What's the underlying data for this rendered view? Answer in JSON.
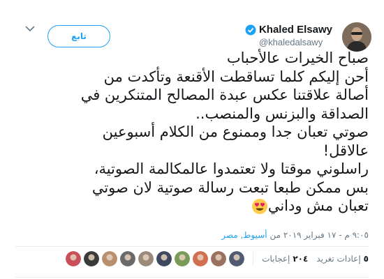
{
  "header": {
    "follow_label": "تابع",
    "display_name": "Khaled Elsawy",
    "handle": "@khaledalsawy"
  },
  "tweet": {
    "lines": [
      "صباح الخيرات عالأحباب",
      "أحن إليكم كلما تساقطت الأقنعة وتأكدت من",
      "أصالة علاقتنا عكس عبدة المصالح المتنكرين في",
      "الصداقة والبزنس والمنصب..",
      "صوتي تعبان جدا وممنوع من الكلام أسبوعين",
      "عالاقل!",
      "راسلوني موقتا ولا تعتمدوا عالمكالمة الصوتية،",
      "بس ممكن طبعا تبعت رسالة صوتية لان صوتي",
      "تعبان مش وداني"
    ],
    "emoji": "heart-eyes-emoji"
  },
  "meta": {
    "timestamp": "٩:٠٥ م - ١٧ فبراير ٢٠١٩ من",
    "location": "أسيوط, مصر"
  },
  "stats": {
    "retweets_count": "٥",
    "retweets_label": "إعادات تغريد",
    "likes_count": "٢٠٤",
    "likes_label": "إعجابات"
  },
  "likers": [
    {
      "name": "liker-1",
      "color": "#c94f5a"
    },
    {
      "name": "liker-2",
      "color": "#3a3a3a"
    },
    {
      "name": "liker-3",
      "color": "#b89070"
    },
    {
      "name": "liker-4",
      "color": "#6a6a6a"
    },
    {
      "name": "liker-5",
      "color": "#9a8a7a"
    },
    {
      "name": "liker-6",
      "color": "#404860"
    },
    {
      "name": "liker-7",
      "color": "#7a9a5a"
    },
    {
      "name": "liker-8",
      "color": "#d07050"
    },
    {
      "name": "liker-9",
      "color": "#9a7060"
    },
    {
      "name": "liker-10",
      "color": "#505a70"
    }
  ],
  "colors": {
    "accent": "#1da1f2",
    "text": "#14171a",
    "muted": "#657786"
  }
}
